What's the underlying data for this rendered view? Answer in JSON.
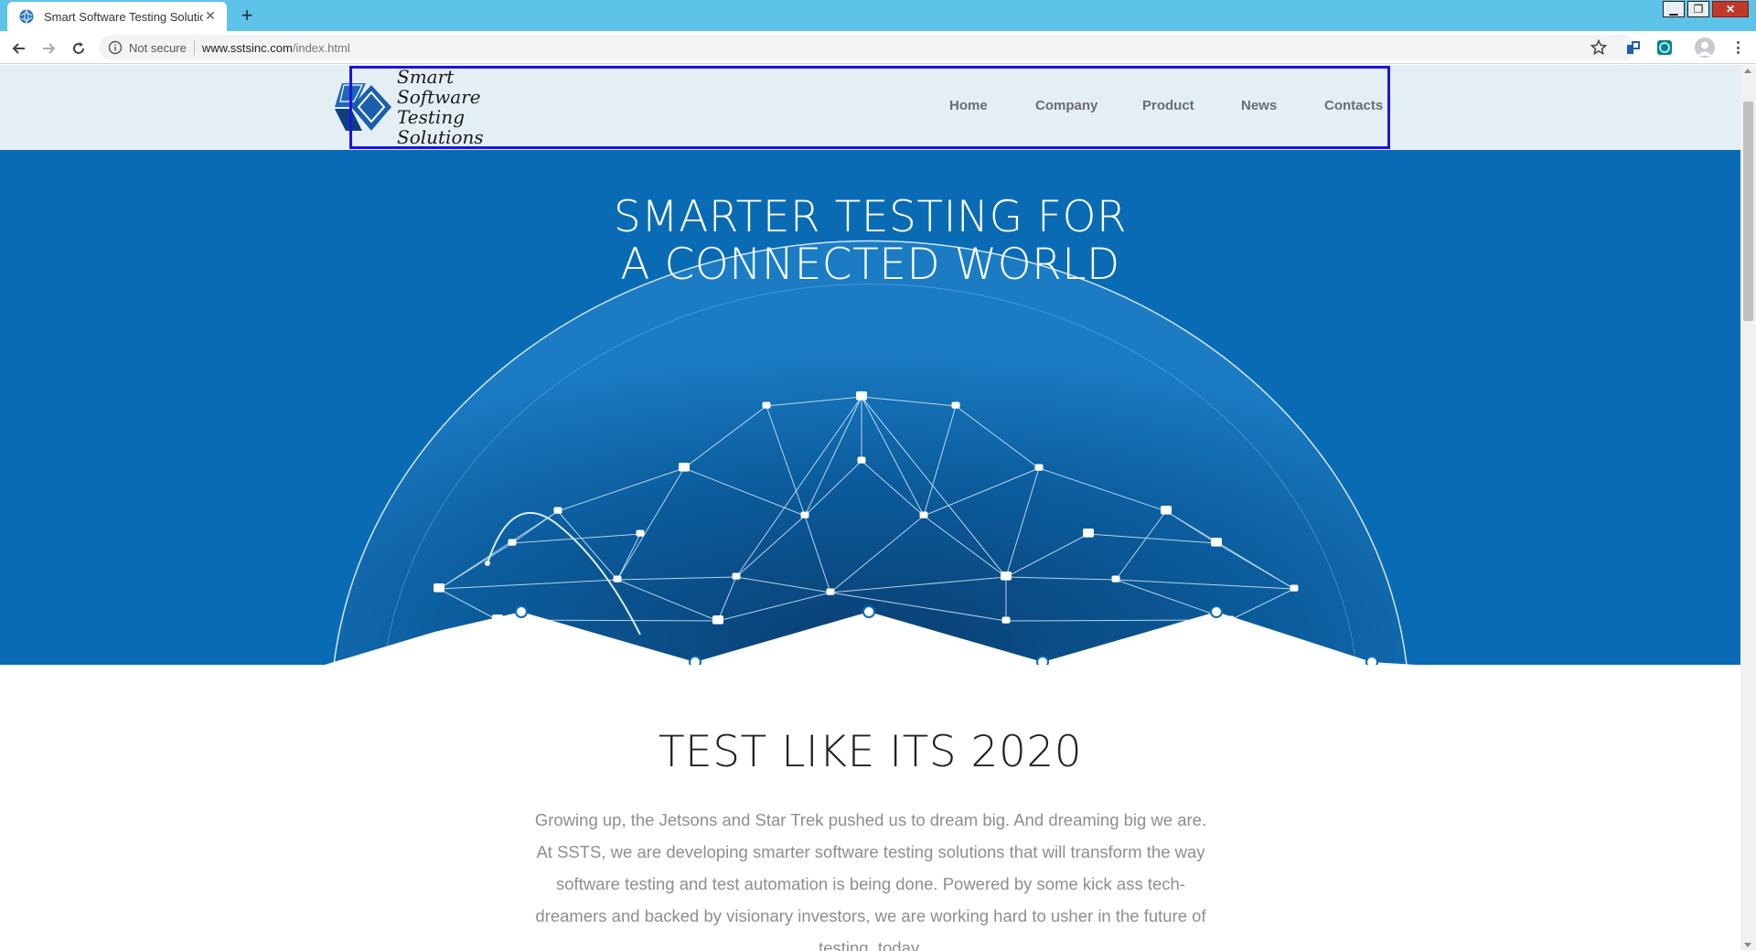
{
  "browser": {
    "tab_title": "Smart Software Testing Solutions",
    "tab_close": "✕",
    "new_tab": "+",
    "security_label": "Not secure",
    "url_host": "www.sstsinc.com",
    "url_path": "/index.html",
    "window_controls": {
      "minimize": "▁",
      "maximize": "❐",
      "close": "✕"
    }
  },
  "site": {
    "logo": {
      "line1": "Smart Software",
      "line2": "Testing Solutions"
    },
    "nav": [
      "Home",
      "Company",
      "Product",
      "News",
      "Contacts"
    ]
  },
  "hero": {
    "title_line1": "SMARTER TESTING FOR",
    "title_line2": "A CONNECTED WORLD"
  },
  "content": {
    "heading": "TEST LIKE ITS 2020",
    "paragraph": "Growing up, the Jetsons and Star Trek pushed us to dream big. And dreaming big we are. At SSTS, we are developing smarter software testing solutions that will transform the way software testing and test automation is being done. Powered by some kick ass tech-dreamers and backed by visionary investors, we are working hard to usher in the future of testing, today."
  },
  "colors": {
    "chrome_tabstrip": "#5ec3e8",
    "header_bg": "#e4eef5",
    "hero_bg": "#0a6bb5",
    "highlight_border": "#1a14e0"
  },
  "icons": {
    "tab": "globe-favicon",
    "back": "arrow-left-icon",
    "forward": "arrow-right-icon",
    "reload": "reload-icon",
    "info": "info-icon",
    "star": "star-icon",
    "profile": "avatar-icon",
    "menu": "more-vert-icon"
  }
}
